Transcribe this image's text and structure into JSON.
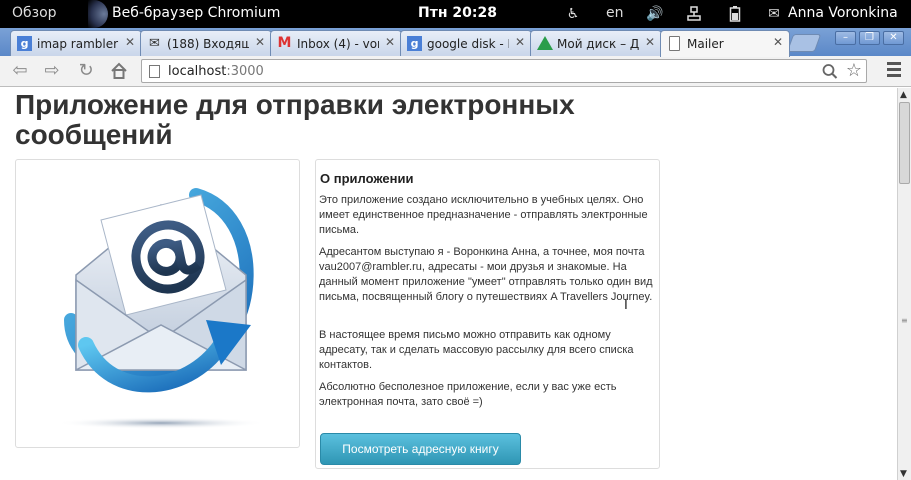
{
  "system_bar": {
    "overview": "Обзор",
    "app_name": "Веб-браузер Chromium",
    "clock": "Птн 20:28",
    "language": "en",
    "user": "Anna Voronkina",
    "icons": [
      "accessibility-icon",
      "volume-icon",
      "network-icon",
      "battery-icon",
      "mail-icon"
    ]
  },
  "tabs": [
    {
      "title": "imap rambler -",
      "icon": "google-icon",
      "active": false
    },
    {
      "title": "(188) Входящ",
      "icon": "envelope-icon",
      "active": false
    },
    {
      "title": "Inbox (4) - vor",
      "icon": "gmail-icon",
      "active": false
    },
    {
      "title": "google disk - I",
      "icon": "google-icon",
      "active": false
    },
    {
      "title": "Мой диск – Д",
      "icon": "drive-icon",
      "active": false
    },
    {
      "title": "Mailer",
      "icon": "page-icon",
      "active": true
    }
  ],
  "toolbar": {
    "url_host": "localhost",
    "url_port": ":3000"
  },
  "page": {
    "title": "Приложение для отправки электронных сообщений",
    "about": {
      "heading": "О приложении",
      "paragraphs": [
        "Это приложение создано исключительно в учебных целях. Оно имеет единственное предназначение - отправлять электронные письма.",
        "Адресантом выступаю я - Воронкина Анна, а точнее, моя почта vau2007@rambler.ru, адресаты - мои друзья и знакомые. На данный момент приложение \"умеет\" отправлять только один вид письма, посвященный блогу о путешествиях A Travellers Journey.",
        "В настоящее время письмо можно отправить как одному адресату, так и сделать массовую рассылку для всего списка контактов.",
        "Абсолютно бесполезное приложение, если у вас уже есть электронная почта, зато своё =)"
      ],
      "button": "Посмотреть адресную книгу"
    }
  },
  "colors": {
    "button_top": "#5bc0de",
    "button_bottom": "#2f96b4",
    "tabstrip": "#6a95cf"
  }
}
